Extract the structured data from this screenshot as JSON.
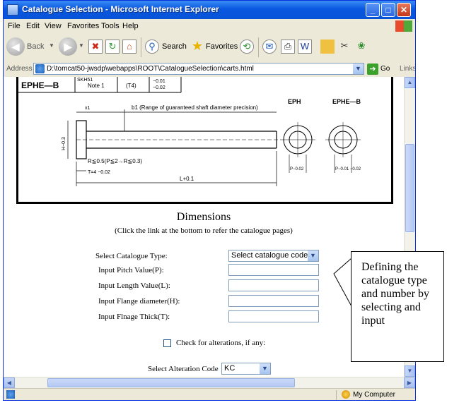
{
  "window": {
    "title": "Catalogue Selection - Microsoft Internet Explorer"
  },
  "menu": {
    "items": [
      "File",
      "Edit",
      "View",
      "Favorites",
      "Tools",
      "Help"
    ]
  },
  "toolbar": {
    "back_label": "Back",
    "search_label": "Search",
    "favorites_label": "Favorites"
  },
  "address": {
    "label": "Address",
    "url": "D:\\tomcat50-jwsdp\\webapps\\ROOT\\CatalogueSelection\\carts.html",
    "go_label": "Go",
    "links_label": "Links"
  },
  "drawing": {
    "table_header": "SKH51",
    "table_row": [
      "EPHE—B",
      "Note 1",
      "(T4)",
      "−0.01",
      "−0.02"
    ],
    "b1_label": "b1 (Range of guaranteed shaft diameter precision)",
    "x1_label": "x1",
    "r_label": "R≦0.5(P≦2→R≦0.3)",
    "t_label": "T=4 −0.02",
    "l_label": "L+0.1",
    "h_label": "H−0.3",
    "eph_label": "EPH",
    "ephe_b_label": "EPHE—B",
    "p_label_left": "P−0.02",
    "p_label_right": "P−0.01 −0.02"
  },
  "form": {
    "title": "Dimensions",
    "subtitle": "(Click the link at the bottom to refer the catalogue pages)",
    "catalogue_type_label": "Select Catalogue Type:",
    "catalogue_type_value": "Select catalogue code",
    "pitch_label": "Input Pitch Value(P):",
    "length_label": "Input Length Value(L):",
    "flange_diameter_label": "Input Flange diameter(H):",
    "flange_thick_label": "Input Flnage Thick(T):",
    "alterations_label": "Check for alterations, if any:",
    "alteration_code_label": "Select Alteration Code",
    "alteration_code_value": "KC"
  },
  "callout": {
    "text": "Defining the catalogue type and number by selecting and input"
  },
  "status": {
    "zone": "My Computer"
  }
}
